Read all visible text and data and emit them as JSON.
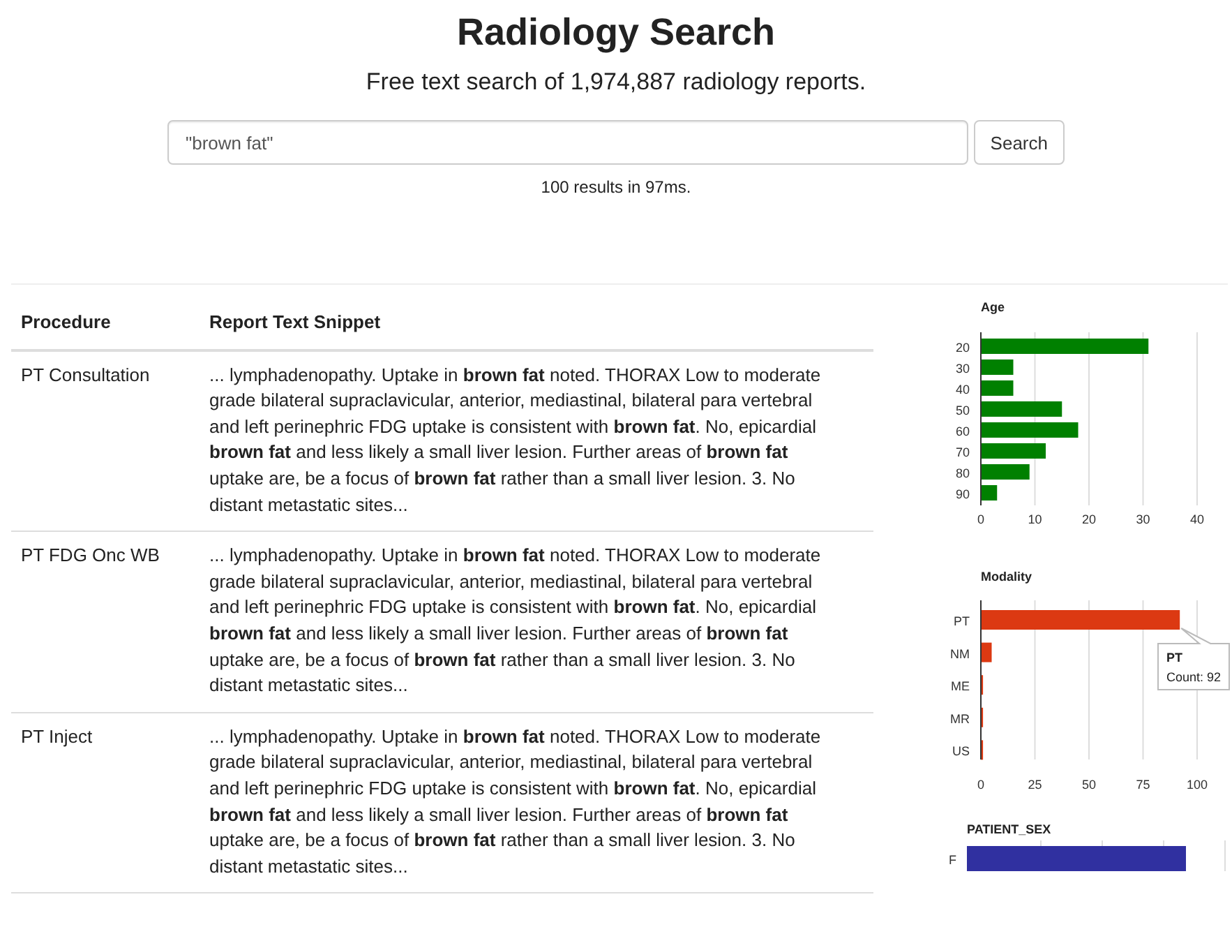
{
  "header": {
    "title": "Radiology Search",
    "subtitle": "Free text search of 1,974,887 radiology reports."
  },
  "search": {
    "value": "\"brown fat\"",
    "button": "Search",
    "result_summary": "100 results in 97ms."
  },
  "table": {
    "columns": [
      "Procedure",
      "Report Text Snippet"
    ],
    "rows": [
      {
        "procedure": "PT Consultation",
        "snippet": "... lymphadenopathy. Uptake in **brown fat** noted. THORAX Low to moderate grade bilateral supraclavicular, anterior, mediastinal, bilateral para vertebral and left perinephric FDG uptake is consistent with **brown fat**. No, epicardial **brown fat** and less likely a small liver lesion. Further areas of **brown fat** uptake are, be a focus of **brown fat** rather than a small liver lesion. 3. No distant metastatic sites..."
      },
      {
        "procedure": "PT FDG Onc WB",
        "snippet": "... lymphadenopathy. Uptake in **brown fat** noted. THORAX Low to moderate grade bilateral supraclavicular, anterior, mediastinal, bilateral para vertebral and left perinephric FDG uptake is consistent with **brown fat**. No, epicardial **brown fat** and less likely a small liver lesion. Further areas of **brown fat** uptake are, be a focus of **brown fat** rather than a small liver lesion. 3. No distant metastatic sites..."
      },
      {
        "procedure": "PT Inject",
        "snippet": "... lymphadenopathy. Uptake in **brown fat** noted. THORAX Low to moderate grade bilateral supraclavicular, anterior, mediastinal, bilateral para vertebral and left perinephric FDG uptake is consistent with **brown fat**. No, epicardial **brown fat** and less likely a small liver lesion. Further areas of **brown fat** uptake are, be a focus of **brown fat** rather than a small liver lesion. 3. No distant metastatic sites..."
      }
    ]
  },
  "charts": [
    {
      "chart_data": {
        "type": "bar",
        "orientation": "horizontal",
        "title": "Age",
        "categories": [
          "20",
          "30",
          "40",
          "50",
          "60",
          "70",
          "80",
          "90"
        ],
        "series": [
          {
            "color": "#008000",
            "values": [
              31,
              6,
              6,
              15,
              18,
              12,
              9,
              3
            ]
          }
        ],
        "xlim": [
          0,
          40
        ],
        "xticks": [
          0,
          10,
          20,
          30,
          40
        ],
        "grid": true
      }
    },
    {
      "chart_data": {
        "type": "bar",
        "orientation": "horizontal",
        "title": "Modality",
        "categories": [
          "PT",
          "NM",
          "ME",
          "MR",
          "US"
        ],
        "series": [
          {
            "color": "#dc3912",
            "values": [
              92,
              5,
              1,
              1,
              1
            ]
          }
        ],
        "xlim": [
          0,
          100
        ],
        "xticks": [
          0,
          25,
          50,
          75,
          100
        ],
        "grid": true
      },
      "tooltip": {
        "title": "PT",
        "text": "Count: 92"
      }
    }
  ],
  "patient_sex_panel": {
    "title": "PATIENT_SEX",
    "labels": [
      "F"
    ]
  }
}
